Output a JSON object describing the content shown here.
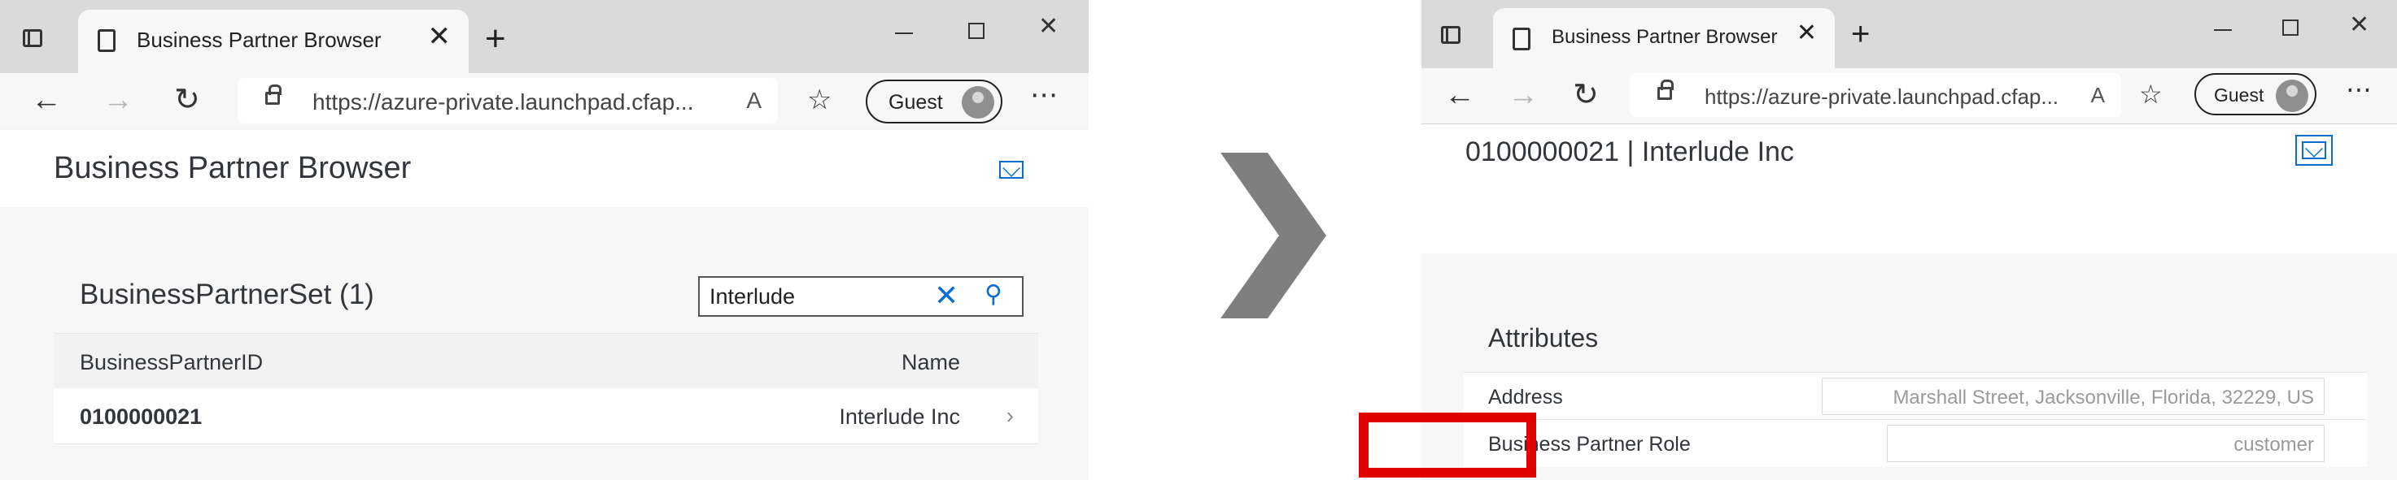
{
  "left_window": {
    "tab_title": "Business Partner Browser",
    "address_url": "https://azure-private.launchpad.cfap...",
    "guest_label": "Guest",
    "page_title": "Business Partner Browser",
    "list": {
      "title": "BusinessPartnerSet (1)",
      "search_value": "Interlude",
      "columns": [
        "BusinessPartnerID",
        "Name"
      ],
      "rows": [
        {
          "id": "0100000021",
          "name": "Interlude Inc"
        }
      ]
    }
  },
  "right_window": {
    "tab_title": "Business Partner Browser",
    "address_url": "https://azure-private.launchpad.cfap...",
    "guest_label": "Guest",
    "object_title": "0100000021 | Interlude Inc",
    "section_title": "Attributes",
    "attributes": [
      {
        "label": "Address",
        "value": "Marshall Street, Jacksonville, Florida, 32229, US"
      },
      {
        "label": "Business Partner Role",
        "value": "customer"
      }
    ]
  },
  "colors": {
    "accent": "#0a6ed1",
    "highlight": "#e00000",
    "chevron": "#7f7f7f"
  },
  "icons": [
    "sidebar-icon",
    "page-icon",
    "close-icon",
    "new-tab-icon",
    "minimize-icon",
    "maximize-icon",
    "back-icon",
    "forward-icon",
    "refresh-icon",
    "lock-icon",
    "read-aloud-icon",
    "favorites-icon",
    "more-icon",
    "email-icon",
    "search-icon",
    "clear-icon",
    "chevron-right-icon"
  ]
}
